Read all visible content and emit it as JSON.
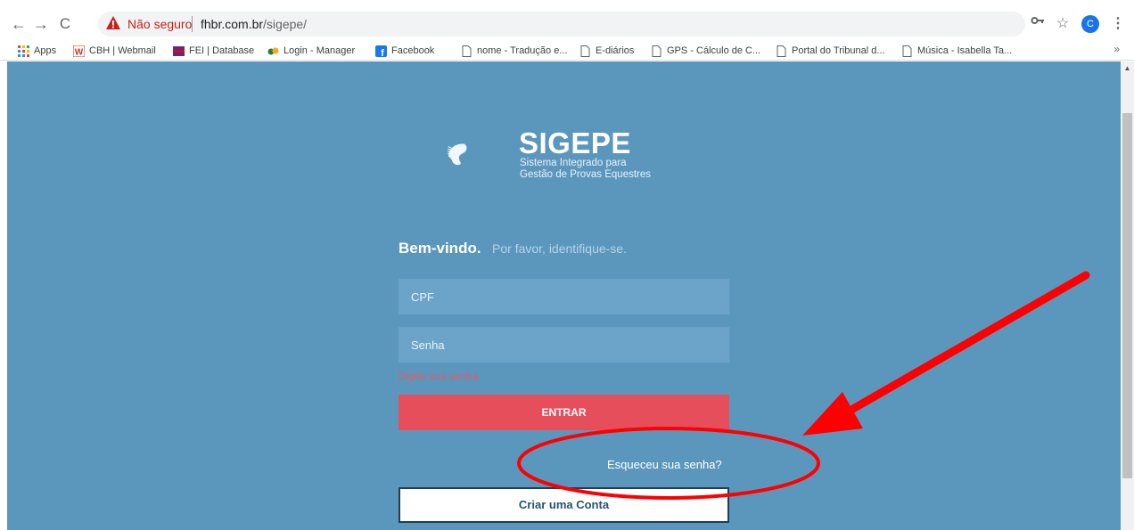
{
  "browser": {
    "omnibox": {
      "security_label": "Não seguro",
      "host": "fhbr.com.br",
      "path": "/sigepe/"
    },
    "profile_initial": "C",
    "bookmarks": [
      {
        "label": "Apps",
        "icon": "apps-grid-icon"
      },
      {
        "label": "CBH | Webmail",
        "icon": "webmail-w-icon"
      },
      {
        "label": "FEI | Database",
        "icon": "fei-logo-icon"
      },
      {
        "label": "Login - Manager",
        "icon": "login-manager-icon"
      },
      {
        "label": "Facebook",
        "icon": "facebook-icon"
      },
      {
        "label": "nome - Tradução e...",
        "icon": "page-icon"
      },
      {
        "label": "E-diários",
        "icon": "page-icon"
      },
      {
        "label": "GPS - Cálculo de C...",
        "icon": "page-icon"
      },
      {
        "label": "Portal do Tribunal d...",
        "icon": "page-icon"
      },
      {
        "label": "Música - Isabella Ta...",
        "icon": "page-icon"
      }
    ],
    "bookmarks_overflow": "»"
  },
  "logo": {
    "title": "SIGEPE",
    "subtitle_line1": "Sistema Integrado para",
    "subtitle_line2": "Gestão de Provas Equestres"
  },
  "login": {
    "welcome_strong": "Bem-vindo.",
    "welcome_soft": "Por favor, identifique-se.",
    "cpf_placeholder": "CPF",
    "password_placeholder": "Senha",
    "password_error": "Digite sua senha",
    "enter_button": "ENTRAR",
    "forgot_link": "Esqueceu sua senha?",
    "create_account_button": "Criar uma Conta"
  },
  "colors": {
    "page_background": "#5b97bd",
    "input_background": "#6ca4c9",
    "enter_button": "#e64e5c",
    "error_text": "#e4596c",
    "annotation_red": "#ff0000"
  }
}
